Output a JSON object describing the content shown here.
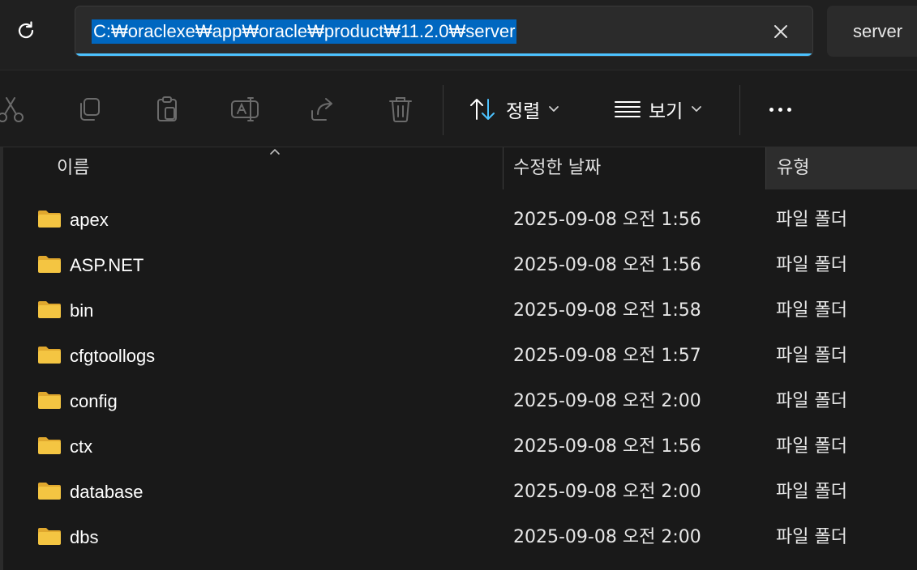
{
  "address_bar": {
    "path": "C:₩oraclexe₩app₩oracle₩product₩11.2.0₩server",
    "search_text": "server"
  },
  "toolbar": {
    "sort_label": "정렬",
    "view_label": "보기"
  },
  "columns": {
    "name": "이름",
    "date_modified": "수정한 날짜",
    "type": "유형"
  },
  "files": [
    {
      "name": "apex",
      "date": "2025-09-08 오전 1:56",
      "type": "파일 폴더"
    },
    {
      "name": "ASP.NET",
      "date": "2025-09-08 오전 1:56",
      "type": "파일 폴더"
    },
    {
      "name": "bin",
      "date": "2025-09-08 오전 1:58",
      "type": "파일 폴더"
    },
    {
      "name": "cfgtoollogs",
      "date": "2025-09-08 오전 1:57",
      "type": "파일 폴더"
    },
    {
      "name": "config",
      "date": "2025-09-08 오전 2:00",
      "type": "파일 폴더"
    },
    {
      "name": "ctx",
      "date": "2025-09-08 오전 1:56",
      "type": "파일 폴더"
    },
    {
      "name": "database",
      "date": "2025-09-08 오전 2:00",
      "type": "파일 폴더"
    },
    {
      "name": "dbs",
      "date": "2025-09-08 오전 2:00",
      "type": "파일 폴더"
    }
  ],
  "colors": {
    "accent": "#4cc2ff",
    "selection": "#0067c0",
    "folder": "#f4c542"
  }
}
